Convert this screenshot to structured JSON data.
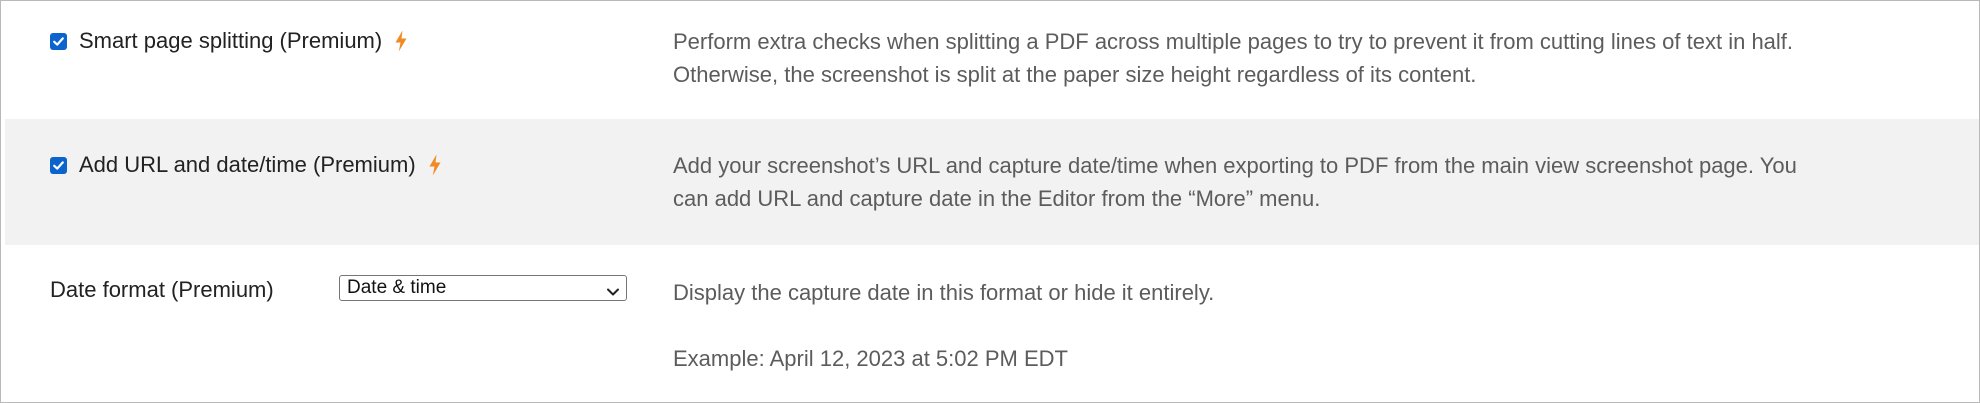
{
  "settings": [
    {
      "label": "Smart page splitting (Premium)",
      "checked": true,
      "premium_icon": "lightning-bolt-icon",
      "description": "Perform extra checks when splitting a PDF across multiple pages to try to prevent it from cutting lines of text in half. Otherwise, the screenshot is split at the paper size height regardless of its content."
    },
    {
      "label": "Add URL and date/time (Premium)",
      "checked": true,
      "premium_icon": "lightning-bolt-icon",
      "description": "Add your screenshot’s URL and capture date/time when exporting to PDF from the main view screenshot page. You can add URL and capture date in the Editor from the “More” menu."
    }
  ],
  "date_format": {
    "label": "Date format (Premium)",
    "selected": "Date & time",
    "description": "Display the capture date in this format or hide it entirely.",
    "example": "Example: April 12, 2023 at 5:02 PM EDT"
  },
  "colors": {
    "accent": "#f08a24",
    "checkbox": "#0b63ce",
    "striped_row": "#f2f2f2",
    "description_text": "#5c5c5c"
  }
}
